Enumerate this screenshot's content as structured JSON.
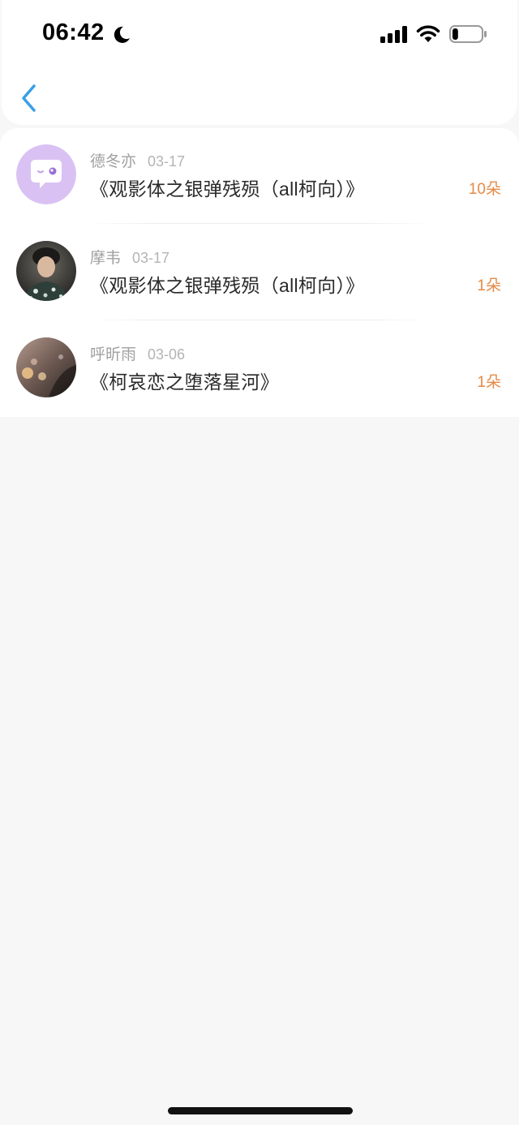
{
  "status_bar": {
    "time": "06:42",
    "moon_icon": "moon-icon",
    "signal_icon": "cellular-signal-icon",
    "wifi_icon": "wifi-icon",
    "battery_icon": "battery-icon",
    "battery_level": 0.2
  },
  "nav": {
    "back_icon": "chevron-left-icon",
    "accent_color": "#3a9fe6"
  },
  "items": [
    {
      "name": "德冬亦",
      "date": "03-17",
      "title": "《观影体之银弹残殒（all柯向）》",
      "count": "10朵",
      "avatar": "default-avatar-icon"
    },
    {
      "name": "摩韦",
      "date": "03-17",
      "title": "《观影体之银弹残殒（all柯向）》",
      "count": "1朵",
      "avatar": "photo-avatar"
    },
    {
      "name": "呼昕雨",
      "date": "03-06",
      "title": "《柯哀恋之堕落星河》",
      "count": "1朵",
      "avatar": "photo-avatar"
    }
  ],
  "colors": {
    "count": "#e58a46",
    "background": "#f7f7f7",
    "default_avatar_bg": "#d9c2f3"
  }
}
